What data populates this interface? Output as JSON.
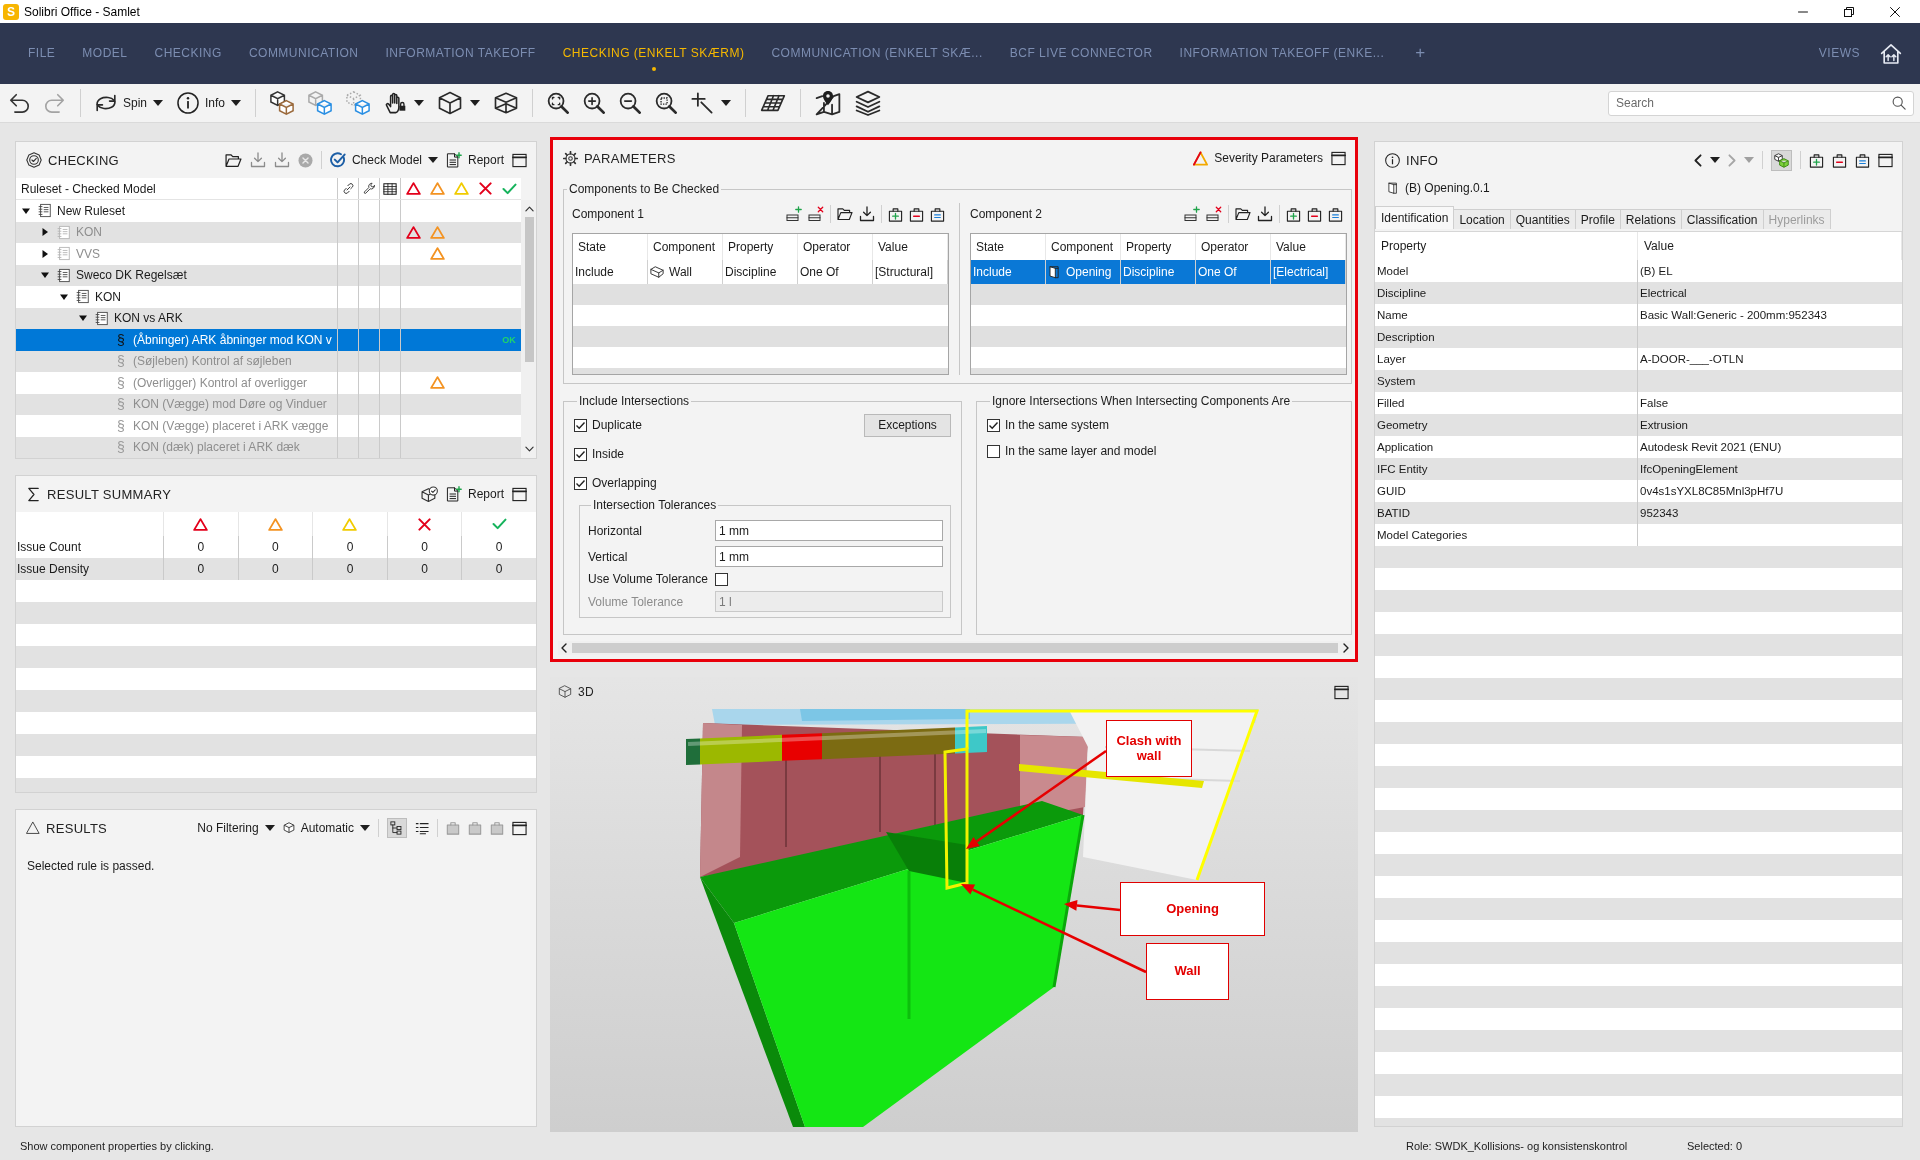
{
  "window": {
    "logo_letter": "S",
    "title": "Solibri Office - Samlet"
  },
  "menu": {
    "items": [
      {
        "label": "FILE",
        "selected": false
      },
      {
        "label": "MODEL",
        "selected": false
      },
      {
        "label": "CHECKING",
        "selected": false
      },
      {
        "label": "COMMUNICATION",
        "selected": false
      },
      {
        "label": "INFORMATION TAKEOFF",
        "selected": false
      },
      {
        "label": "CHECKING (ENKELT SKÆRM)",
        "selected": true
      },
      {
        "label": "COMMUNICATION (ENKELT SKÆ...",
        "selected": false
      },
      {
        "label": "BCF LIVE CONNECTOR",
        "selected": false
      },
      {
        "label": "INFORMATION TAKEOFF (ENKE...",
        "selected": false
      }
    ],
    "add_label": "+",
    "views_label": "VIEWS"
  },
  "toolbar": {
    "spin_label": "Spin",
    "info_label": "Info",
    "search": {
      "placeholder": "Search"
    }
  },
  "checking": {
    "title": "CHECKING",
    "check_model_label": "Check Model",
    "report_label": "Report",
    "column_header": "Ruleset - Checked Model",
    "severity_columns": [
      {
        "kind": "critical"
      },
      {
        "kind": "moderate"
      },
      {
        "kind": "low"
      },
      {
        "kind": "rejected"
      },
      {
        "kind": "accepted"
      }
    ],
    "tree": [
      {
        "kind": "ruleset",
        "label": "New Ruleset",
        "expanded": true,
        "selected": false,
        "disabled": false,
        "children": [
          {
            "kind": "ruleset",
            "label": "KON",
            "expanded": false,
            "selected": false,
            "disabled": true,
            "issues": [
              {
                "kind": "critical"
              },
              {
                "kind": "moderate"
              }
            ]
          },
          {
            "kind": "ruleset",
            "label": "VVS",
            "expanded": false,
            "selected": false,
            "disabled": true,
            "issues": [
              {
                "kind": "moderate"
              }
            ]
          },
          {
            "kind": "ruleset",
            "label": "Sweco DK Regelsæt",
            "expanded": true,
            "selected": false,
            "disabled": false,
            "children": [
              {
                "kind": "ruleset",
                "label": "KON",
                "expanded": true,
                "selected": false,
                "disabled": false,
                "children": [
                  {
                    "kind": "ruleset",
                    "label": "KON vs ARK",
                    "expanded": true,
                    "selected": false,
                    "disabled": false,
                    "children": [
                      {
                        "kind": "rule",
                        "icon": "§",
                        "label": "(Åbninger) ARK åbninger mod KON v",
                        "selected": true,
                        "disabled": false,
                        "result": "OK"
                      },
                      {
                        "kind": "rule",
                        "icon": "§",
                        "label": "(Søjleben) Kontrol af søjleben",
                        "selected": false,
                        "disabled": true
                      },
                      {
                        "kind": "rule",
                        "icon": "§",
                        "label": "(Overligger) Kontrol af overligger",
                        "selected": false,
                        "disabled": true,
                        "issues": [
                          {
                            "kind": "moderate"
                          }
                        ]
                      },
                      {
                        "kind": "rule",
                        "icon": "§",
                        "label": "KON (Vægge) mod Døre og Vinduer",
                        "selected": false,
                        "disabled": true
                      },
                      {
                        "kind": "rule",
                        "icon": "§",
                        "label": "KON (Vægge) placeret i ARK vægge",
                        "selected": false,
                        "disabled": true
                      },
                      {
                        "kind": "rule",
                        "icon": "§",
                        "label": "KON (dæk) placeret i ARK dæk",
                        "selected": false,
                        "disabled": true
                      }
                    ]
                  }
                ]
              }
            ]
          }
        ]
      }
    ]
  },
  "result_summary": {
    "title": "RESULT SUMMARY",
    "report_label": "Report",
    "columns": [
      {
        "kind": "critical"
      },
      {
        "kind": "moderate"
      },
      {
        "kind": "low"
      },
      {
        "kind": "rejected"
      },
      {
        "kind": "accepted"
      }
    ],
    "rows": [
      {
        "label": "Issue Count",
        "values": [
          "0",
          "0",
          "0",
          "0",
          "0"
        ]
      },
      {
        "label": "Issue Density",
        "values": [
          "0",
          "0",
          "0",
          "0",
          "0"
        ]
      }
    ]
  },
  "results": {
    "title": "RESULTS",
    "filter": "No Filtering",
    "mode": "Automatic",
    "message": "Selected rule is passed."
  },
  "parameters": {
    "title": "PARAMETERS",
    "severity_label": "Severity Parameters",
    "components_group": {
      "title": "Components to Be Checked",
      "tables": [
        {
          "title": "Component 1",
          "columns": [
            "State",
            "Component",
            "Property",
            "Operator",
            "Value"
          ],
          "rows": [
            {
              "kind": "wall",
              "selected": false,
              "cells": [
                "Include",
                "Wall",
                "Discipline",
                "One Of",
                "[Structural]"
              ]
            }
          ]
        },
        {
          "title": "Component 2",
          "columns": [
            "State",
            "Component",
            "Property",
            "Operator",
            "Value"
          ],
          "rows": [
            {
              "kind": "opening",
              "selected": true,
              "cells": [
                "Include",
                "Opening",
                "Discipline",
                "One Of",
                "[Electrical]"
              ]
            }
          ]
        }
      ]
    },
    "include_group": {
      "title": "Include Intersections",
      "exceptions_label": "Exceptions",
      "options": [
        {
          "label": "Duplicate",
          "checked": true
        },
        {
          "label": "Inside",
          "checked": true
        },
        {
          "label": "Overlapping",
          "checked": true
        }
      ],
      "tolerances": {
        "title": "Intersection Tolerances",
        "fields": [
          {
            "kind": "input",
            "label": "Horizontal",
            "value": "1 mm",
            "disabled": false
          },
          {
            "kind": "input",
            "label": "Vertical",
            "value": "1 mm",
            "disabled": false
          },
          {
            "kind": "checkbox",
            "label": "Use Volume Tolerance",
            "checked": false,
            "disabled": false
          },
          {
            "kind": "input",
            "label": "Volume Tolerance",
            "value": "1 l",
            "disabled": true
          }
        ]
      }
    },
    "ignore_group": {
      "title": "Ignore Intersections When Intersecting Components Are",
      "options": [
        {
          "label": "In the same system",
          "checked": true
        },
        {
          "label": "In the same layer and model",
          "checked": false
        }
      ]
    }
  },
  "viewport": {
    "title": "3D",
    "callouts": [
      {
        "text": "Clash with wall"
      },
      {
        "text": "Opening"
      },
      {
        "text": "Wall"
      }
    ]
  },
  "info": {
    "title": "INFO",
    "object": "(B) Opening.0.1",
    "tabs": [
      {
        "label": "Identification",
        "selected": true,
        "disabled": false
      },
      {
        "label": "Location",
        "selected": false,
        "disabled": false
      },
      {
        "label": "Quantities",
        "selected": false,
        "disabled": false
      },
      {
        "label": "Profile",
        "selected": false,
        "disabled": false
      },
      {
        "label": "Relations",
        "selected": false,
        "disabled": false
      },
      {
        "label": "Classification",
        "selected": false,
        "disabled": false
      },
      {
        "label": "Hyperlinks",
        "selected": false,
        "disabled": true
      }
    ],
    "columns": [
      "Property",
      "Value"
    ],
    "rows": [
      {
        "property": "Model",
        "value": "(B) EL"
      },
      {
        "property": "Discipline",
        "value": "Electrical"
      },
      {
        "property": "Name",
        "value": "Basic Wall:Generic - 200mm:952343"
      },
      {
        "property": "Description"
      },
      {
        "property": "Layer",
        "value": "A-DOOR-___-OTLN"
      },
      {
        "property": "System"
      },
      {
        "property": "Filled",
        "value": "False"
      },
      {
        "property": "Geometry",
        "value": "Extrusion"
      },
      {
        "property": "Application",
        "value": "Autodesk Revit 2021 (ENU)"
      },
      {
        "property": "IFC Entity",
        "value": "IfcOpeningElement"
      },
      {
        "property": "GUID",
        "value": "0v4s1sYXL8C85Mnl3pHf7U"
      },
      {
        "property": "BATID",
        "value": "952343"
      },
      {
        "property": "Model Categories"
      }
    ]
  },
  "status_bar": {
    "hint": "Show component properties by clicking.",
    "role": "Role: SWDK_Kollisions- og konsistenskontrol",
    "selection": "Selected: 0"
  }
}
